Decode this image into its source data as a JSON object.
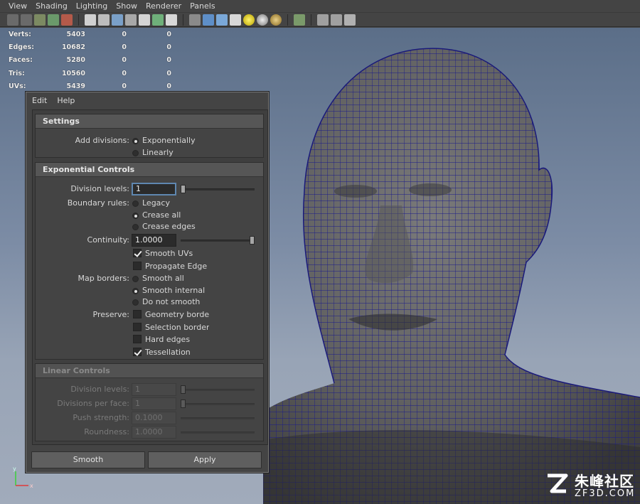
{
  "menubar": [
    "View",
    "Shading",
    "Lighting",
    "Show",
    "Renderer",
    "Panels"
  ],
  "hud": [
    {
      "k": "Verts:",
      "v1": "5403",
      "v2": "0",
      "v3": "0"
    },
    {
      "k": "Edges:",
      "v1": "10682",
      "v2": "0",
      "v3": "0"
    },
    {
      "k": "Faces:",
      "v1": "5280",
      "v2": "0",
      "v3": "0"
    },
    {
      "k": "Tris:",
      "v1": "10560",
      "v2": "0",
      "v3": "0"
    },
    {
      "k": "UVs:",
      "v1": "5439",
      "v2": "0",
      "v3": "0"
    }
  ],
  "dialog": {
    "menu": {
      "edit": "Edit",
      "help": "Help"
    },
    "settings": {
      "title": "Settings",
      "add_divisions_label": "Add divisions:",
      "opt_exponentially": "Exponentially",
      "opt_linearly": "Linearly"
    },
    "exponential": {
      "title": "Exponential Controls",
      "division_levels_label": "Division levels:",
      "division_levels_value": "1",
      "boundary_rules_label": "Boundary rules:",
      "opt_legacy": "Legacy",
      "opt_crease_all": "Crease all",
      "opt_crease_edges": "Crease edges",
      "continuity_label": "Continuity:",
      "continuity_value": "1.0000",
      "smooth_uvs": "Smooth UVs",
      "propagate_edge": "Propagate Edge",
      "map_borders_label": "Map borders:",
      "opt_smooth_all": "Smooth all",
      "opt_smooth_internal": "Smooth internal",
      "opt_do_not_smooth": "Do not smooth",
      "preserve_label": "Preserve:",
      "geometry_borders": "Geometry border",
      "selection_borders": "Selection borders",
      "hard_edges": "Hard edges",
      "tessellation": "Tessellation"
    },
    "linear": {
      "title": "Linear Controls",
      "division_levels_label": "Division levels:",
      "division_levels_value": "1",
      "divisions_per_face_label": "Divisions per face:",
      "divisions_per_face_value": "1",
      "push_strength_label": "Push strength:",
      "push_strength_value": "0.1000",
      "roundness_label": "Roundness:",
      "roundness_value": "1.0000"
    },
    "buttons": {
      "smooth": "Smooth",
      "apply": "Apply"
    }
  },
  "watermark": {
    "cn": "朱峰社区",
    "en": "ZF3D.COM"
  },
  "axis": {
    "y": "y",
    "x": "x"
  }
}
